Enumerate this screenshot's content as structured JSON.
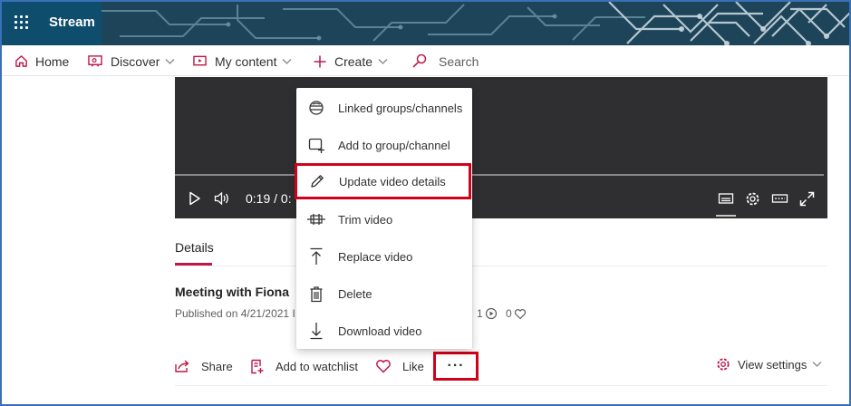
{
  "app": {
    "title": "Stream",
    "icon": "waffle-icon"
  },
  "nav": {
    "home": "Home",
    "discover": "Discover",
    "my_content": "My content",
    "create": "Create",
    "search": "Search"
  },
  "player": {
    "time_current": "0:19",
    "time_separator": "/",
    "time_total_partial": "0:"
  },
  "details": {
    "tab_label": "Details",
    "video_title": "Meeting with Fiona",
    "published": "Published on 4/21/2021 I",
    "views_count": "1",
    "likes_count": "0"
  },
  "actions": {
    "share": "Share",
    "add_to_watchlist": "Add to watchlist",
    "like": "Like",
    "more": "···",
    "view_settings": "View settings"
  },
  "menu": {
    "items": [
      {
        "label": "Linked groups/channels",
        "icon": "linked-groups-icon"
      },
      {
        "label": "Add to group/channel",
        "icon": "add-to-group-icon"
      },
      {
        "label": "Update video details",
        "icon": "pencil-icon",
        "highlighted": true
      },
      {
        "label": "Trim video",
        "icon": "trim-icon"
      },
      {
        "label": "Replace video",
        "icon": "replace-icon"
      },
      {
        "label": "Delete",
        "icon": "trash-icon"
      },
      {
        "label": "Download video",
        "icon": "download-icon"
      }
    ]
  },
  "colors": {
    "accent": "#bc1948",
    "highlight_border": "#d0021b",
    "brand_bar": "#0f4d6c",
    "player_bg": "#2f2e30"
  }
}
